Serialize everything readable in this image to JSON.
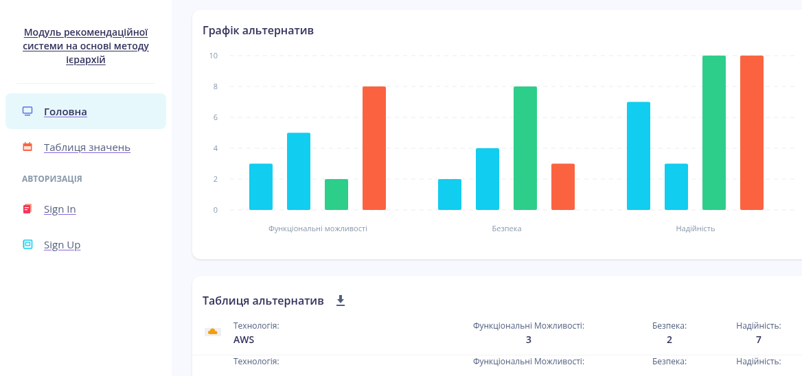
{
  "sidebar": {
    "title": "Модуль рекомендаційної системи на основі методу ієрархій",
    "items": [
      {
        "label": "Головна",
        "kind": "monitor",
        "selected": true
      },
      {
        "label": "Таблиця значень",
        "kind": "calendar",
        "selected": false
      }
    ],
    "section_heading": "АВТОРИЗАЦІЯ",
    "auth_items": [
      {
        "label": "Sign In",
        "kind": "pages",
        "selected": false
      },
      {
        "label": "Sign Up",
        "kind": "notebook",
        "selected": false
      }
    ]
  },
  "chart_card": {
    "title": "Графік альтернатив",
    "chart_data": {
      "type": "bar",
      "categories": [
        "Функціональні можливості",
        "Безпека",
        "Надійність"
      ],
      "series": [
        {
          "color": "#11cdef",
          "values": [
            3,
            2,
            7
          ]
        },
        {
          "color": "#11cdef",
          "values": [
            5,
            4,
            3
          ]
        },
        {
          "color": "#2dce89",
          "values": [
            2,
            8,
            10
          ]
        },
        {
          "color": "#fb6340",
          "values": [
            8,
            3,
            10
          ]
        }
      ],
      "ylim": [
        0,
        10
      ],
      "grid": true,
      "yticks": [
        0,
        2,
        4,
        6,
        8,
        10
      ]
    }
  },
  "table_card": {
    "title": "Таблиця альтернатив",
    "rows": [
      {
        "technology_label": "Технологія:",
        "technology": "AWS",
        "functional_label": "Функціональні Можливості:",
        "functional": "3",
        "security_label": "Безпека:",
        "security": "2",
        "reliability_label": "Надійність:",
        "reliability": "7"
      },
      {
        "technology_label": "Технологія:",
        "functional_label": "Функціональні Можливості:",
        "security_label": "Безпека:",
        "reliability_label": "Надійність:"
      }
    ]
  }
}
